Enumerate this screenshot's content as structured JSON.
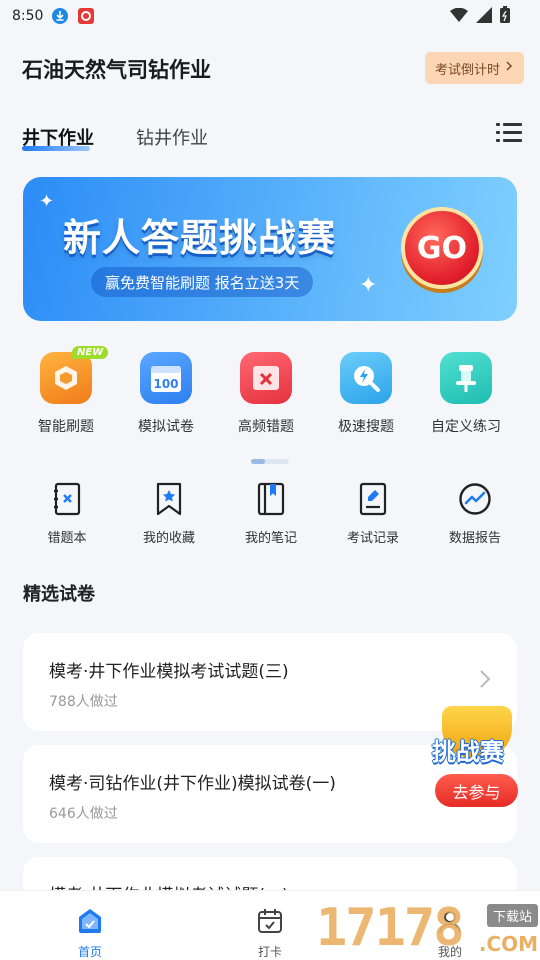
{
  "status_bar": {
    "time": "8:50"
  },
  "header": {
    "title": "石油天然气司钻作业",
    "countdown_label": "考试倒计时"
  },
  "tabs": [
    {
      "label": "井下作业",
      "active": true
    },
    {
      "label": "钻井作业",
      "active": false
    }
  ],
  "banner": {
    "title": "新人答题挑战赛",
    "subtitle": "赢免费智能刷题  报名立送3天",
    "go_label": "GO"
  },
  "features": [
    {
      "label": "智能刷题",
      "badge": "NEW",
      "icon": "smart-practice-icon",
      "color": "#f7962b"
    },
    {
      "label": "模拟试卷",
      "icon": "mock-exam-icon",
      "color": "#3a8df5",
      "icon_text": "100"
    },
    {
      "label": "高频错题",
      "icon": "frequent-mistakes-icon",
      "color": "#f0434f"
    },
    {
      "label": "极速搜题",
      "icon": "quick-search-icon",
      "color": "#37b4f0"
    },
    {
      "label": "自定义练习",
      "icon": "custom-practice-icon",
      "color": "#2ccfc4"
    }
  ],
  "tools": [
    {
      "label": "错题本",
      "icon": "mistake-book-icon"
    },
    {
      "label": "我的收藏",
      "icon": "bookmark-icon"
    },
    {
      "label": "我的笔记",
      "icon": "notes-icon"
    },
    {
      "label": "考试记录",
      "icon": "exam-record-icon"
    },
    {
      "label": "数据报告",
      "icon": "data-report-icon"
    }
  ],
  "section": {
    "title": "精选试卷"
  },
  "papers": [
    {
      "title": "模考·井下作业模拟考试试题(三)",
      "meta": "788人做过"
    },
    {
      "title": "模考·司钻作业(井下作业)模拟试卷(一)",
      "meta": "646人做过"
    },
    {
      "title": "模考·井下作业模拟考试试题(一)",
      "meta": ""
    }
  ],
  "promo": {
    "title": "挑战赛",
    "button": "去参与"
  },
  "bottom_nav": [
    {
      "label": "首页",
      "active": true,
      "icon": "home-icon"
    },
    {
      "label": "打卡",
      "active": false,
      "icon": "calendar-icon"
    },
    {
      "label": "我的",
      "active": false,
      "icon": "profile-icon"
    }
  ],
  "watermark": {
    "number": "17178",
    "tag": "下载站",
    "domain": ".COM"
  },
  "colors": {
    "accent": "#1e7bf2",
    "countdown_bg": "#fcd6b5",
    "promo_red": "#e62c26"
  }
}
